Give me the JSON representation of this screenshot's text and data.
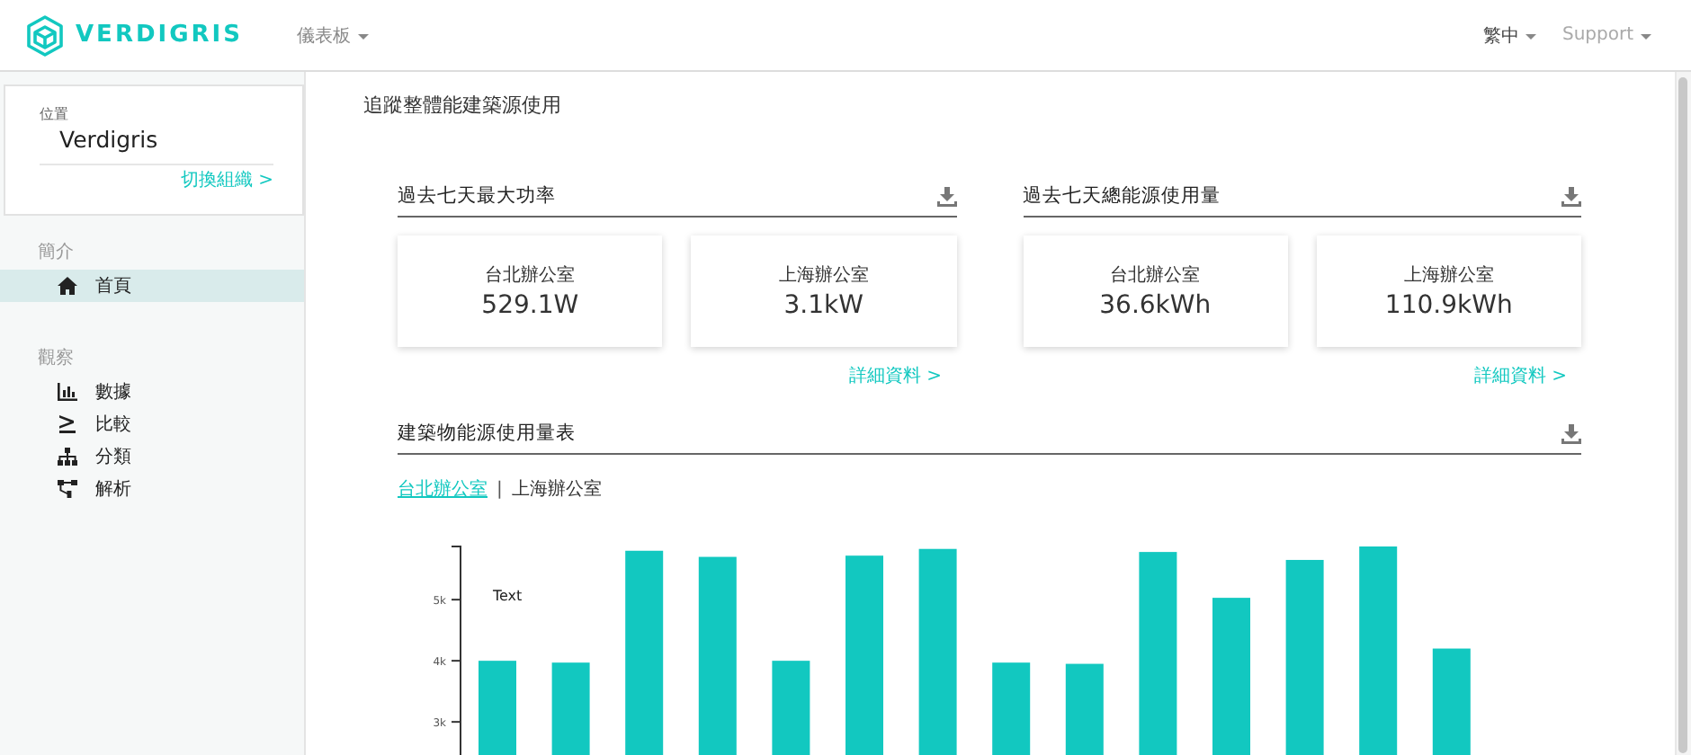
{
  "header": {
    "logo": "VERDIGRIS",
    "menu": "儀表板",
    "language": "繁中",
    "support": "Support"
  },
  "sidebar": {
    "location_label": "位置",
    "organization": "Verdigris",
    "switch_link": "切換組織 >",
    "sections": [
      {
        "title": "簡介",
        "items": [
          {
            "label": "首頁",
            "kind": "home",
            "selected": true
          }
        ]
      },
      {
        "title": "觀察",
        "items": [
          {
            "label": "數據",
            "kind": "bar-chart",
            "selected": false
          },
          {
            "label": "比較",
            "kind": "compare",
            "selected": false
          },
          {
            "label": "分類",
            "kind": "hierarchy",
            "selected": false
          },
          {
            "label": "解析",
            "kind": "network",
            "selected": false
          }
        ]
      }
    ]
  },
  "main": {
    "title": "追蹤整體能建築源使用",
    "panels": [
      {
        "title": "過去七天最大功率",
        "cards": [
          {
            "name": "台北辦公室",
            "value": "529.1W"
          },
          {
            "name": "上海辦公室",
            "value": "3.1kW"
          }
        ],
        "link": "詳細資料 >"
      },
      {
        "title": "過去七天總能源使用量",
        "cards": [
          {
            "name": "台北辦公室",
            "value": "36.6kWh"
          },
          {
            "name": "上海辦公室",
            "value": "110.9kWh"
          }
        ],
        "link": "詳細資料 >"
      }
    ],
    "chart_section": {
      "title": "建築物能源使用量表",
      "tabs": [
        {
          "label": "台北辦公室",
          "selected": true
        },
        {
          "label": "上海辦公室",
          "selected": false
        }
      ],
      "tab_separator": "|",
      "chart_data": {
        "type": "bar",
        "series": [
          {
            "color": "#12c8c0",
            "values": [
              4000,
              3970,
              5800,
              5700,
              4000,
              5720,
              5830,
              3970,
              3950,
              5780,
              5030,
              5650,
              5870,
              4200
            ]
          }
        ],
        "ylim": [
          0,
          5870
        ],
        "yticks": [
          {
            "value": 3000,
            "label": "3k"
          },
          {
            "value": 4000,
            "label": "4k"
          },
          {
            "value": 5000,
            "label": "5k"
          }
        ],
        "annotations": [
          "Text"
        ]
      }
    }
  }
}
